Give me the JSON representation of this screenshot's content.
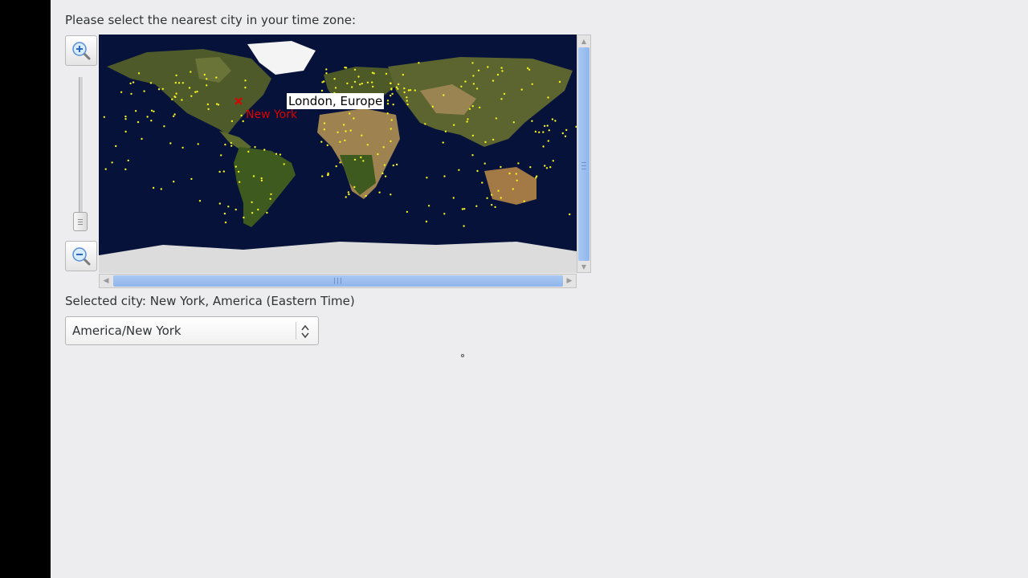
{
  "prompt": "Please select the nearest city in your time zone:",
  "map": {
    "hover_city_label": "London, Europe",
    "marked_city_label": "New York",
    "colors": {
      "ocean": "#06123a",
      "city_dot": "#f2f21e",
      "marker": "#e00000"
    }
  },
  "zoom": {
    "in_icon": "zoom-in-icon",
    "out_icon": "zoom-out-icon"
  },
  "selected_city_text": "Selected city: New York, America (Eastern Time)",
  "timezone_select": {
    "value": "America/New York"
  }
}
